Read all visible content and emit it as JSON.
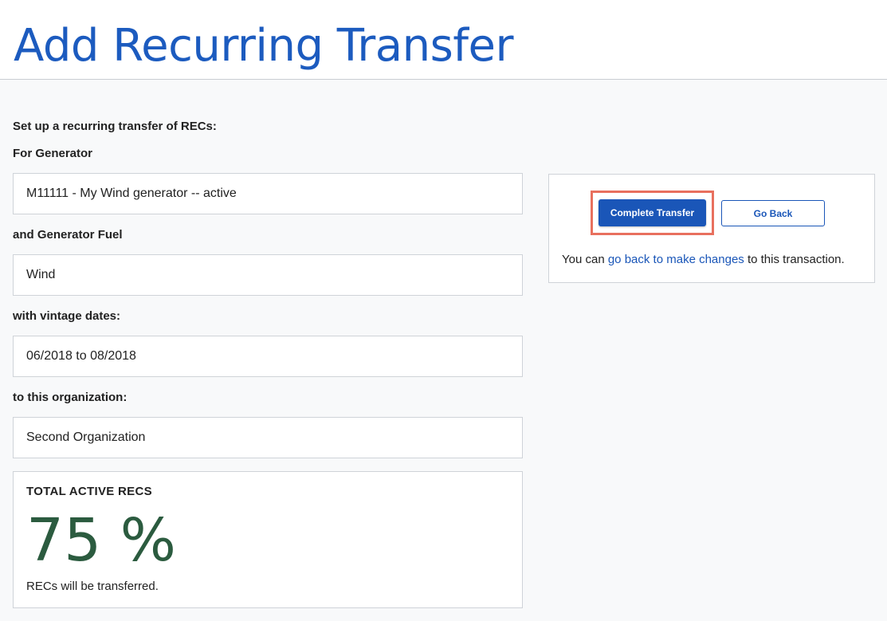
{
  "header": {
    "title": "Add Recurring Transfer"
  },
  "form": {
    "intro": "Set up a recurring transfer of RECs:",
    "generator_label": "For Generator",
    "generator_value": "M11111 - My Wind generator -- active",
    "fuel_label": "and Generator Fuel",
    "fuel_value": "Wind",
    "vintage_label": "with vintage dates:",
    "vintage_value": "06/2018 to 08/2018",
    "organization_label": "to this organization:",
    "organization_value": "Second Organization"
  },
  "total": {
    "title": "TOTAL ACTIVE RECS",
    "value": "75 %",
    "percent": 75,
    "note": "RECs will be transferred."
  },
  "actions": {
    "complete_label": "Complete Transfer",
    "back_label": "Go Back",
    "text_prefix": "You can ",
    "link_text": "go back to make changes",
    "text_suffix": " to this transaction."
  },
  "colors": {
    "title": "#1c5bbf",
    "primary_button": "#1a56b8",
    "highlight": "#e8705e",
    "total_value": "#2b5b3f"
  }
}
